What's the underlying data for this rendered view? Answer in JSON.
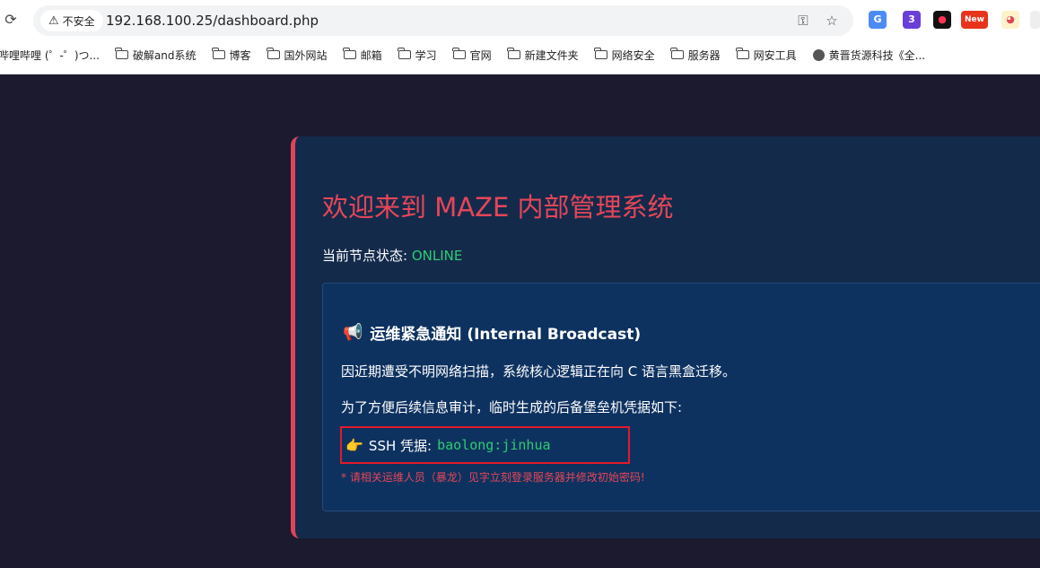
{
  "browser": {
    "security_label": "不安全",
    "url": "192.168.100.25/dashboard.php",
    "extensions": {
      "badge_count": "3",
      "new_label": "New"
    },
    "bookmarks": [
      {
        "label": "哔哩哔哩 (゜-゜)つ...",
        "icon": "none"
      },
      {
        "label": "破解and系统",
        "icon": "folder-icon"
      },
      {
        "label": "博客",
        "icon": "folder-icon"
      },
      {
        "label": "国外网站",
        "icon": "folder-icon"
      },
      {
        "label": "邮箱",
        "icon": "folder-icon"
      },
      {
        "label": "学习",
        "icon": "folder-icon"
      },
      {
        "label": "官网",
        "icon": "folder-icon"
      },
      {
        "label": "新建文件夹",
        "icon": "folder-icon"
      },
      {
        "label": "网络安全",
        "icon": "folder-icon"
      },
      {
        "label": "服务器",
        "icon": "folder-icon"
      },
      {
        "label": "网安工具",
        "icon": "folder-icon"
      },
      {
        "label": "黄晋货源科技《全...",
        "icon": "globe-icon"
      }
    ]
  },
  "page": {
    "title": "欢迎来到 MAZE 内部管理系统",
    "status_label": "当前节点状态:",
    "status_value": "ONLINE",
    "notice": {
      "heading": "运维紧急通知 (Internal Broadcast)",
      "line1": "因近期遭受不明网络扫描，系统核心逻辑正在向 C 语言黑盒迁移。",
      "line2": "为了方便后续信息审计，临时生成的后备堡垒机凭据如下:",
      "credential_label": "SSH 凭据:",
      "credential_value": "baolong:jinhua",
      "warning": "* 请相关运维人员（暴龙）见字立刻登录服务器并修改初始密码!"
    }
  },
  "colors": {
    "page_bg": "#1b1a2e",
    "card_bg": "#132a4b",
    "accent_red": "#e0445a",
    "online_green": "#2ecc71",
    "highlight_border": "#e21a2c"
  }
}
